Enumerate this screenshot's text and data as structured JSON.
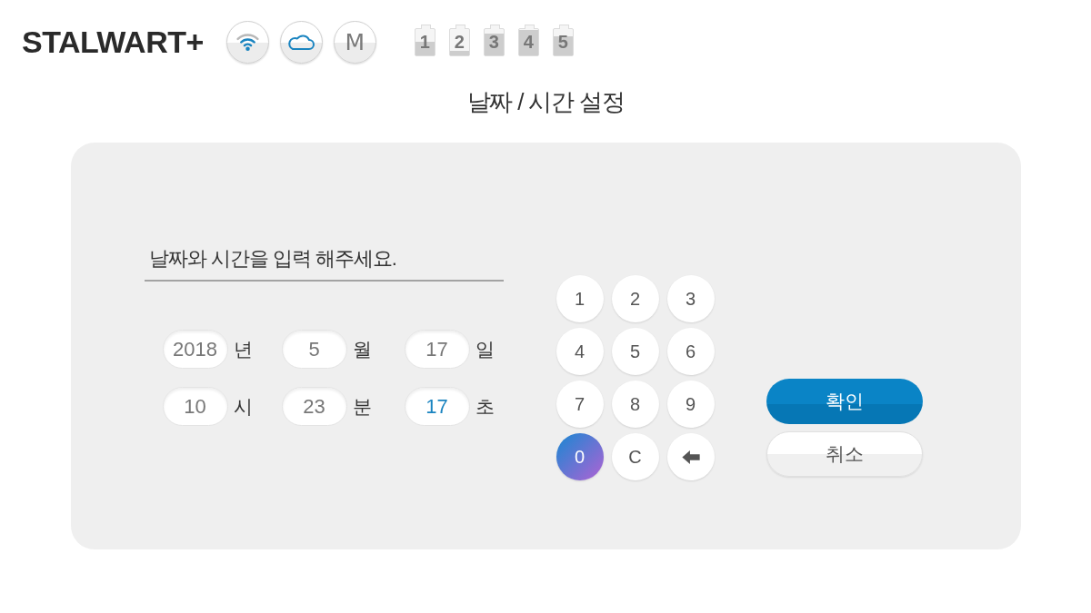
{
  "header": {
    "logo": "STALWART+",
    "status_letter": "M",
    "batteries": [
      {
        "label": "1",
        "level": 0.5
      },
      {
        "label": "2",
        "level": 0.15
      },
      {
        "label": "3",
        "level": 0.8
      },
      {
        "label": "4",
        "level": 0.95
      },
      {
        "label": "5",
        "level": 0.7
      }
    ]
  },
  "title": "날짜 / 시간 설정",
  "dialog": {
    "instruction": "날짜와 시간을 입력 해주세요.",
    "fields": [
      {
        "value": "2018",
        "unit": "년",
        "selected": false
      },
      {
        "value": "5",
        "unit": "월",
        "selected": false
      },
      {
        "value": "17",
        "unit": "일",
        "selected": false
      },
      {
        "value": "10",
        "unit": "시",
        "selected": false
      },
      {
        "value": "23",
        "unit": "분",
        "selected": false
      },
      {
        "value": "17",
        "unit": "초",
        "selected": true
      }
    ],
    "keypad": [
      {
        "kind": "key",
        "label": "1",
        "selected": false
      },
      {
        "kind": "key",
        "label": "2",
        "selected": false
      },
      {
        "kind": "key",
        "label": "3",
        "selected": false
      },
      {
        "kind": "key",
        "label": "4",
        "selected": false
      },
      {
        "kind": "key",
        "label": "5",
        "selected": false
      },
      {
        "kind": "key",
        "label": "6",
        "selected": false
      },
      {
        "kind": "key",
        "label": "7",
        "selected": false
      },
      {
        "kind": "key",
        "label": "8",
        "selected": false
      },
      {
        "kind": "key",
        "label": "9",
        "selected": false
      },
      {
        "kind": "key",
        "label": "0",
        "selected": true
      },
      {
        "kind": "key",
        "label": "C",
        "selected": false
      },
      {
        "kind": "backspace",
        "selected": false
      }
    ],
    "buttons": [
      {
        "kind": "primary",
        "label": "확인"
      },
      {
        "kind": "secondary",
        "label": "취소"
      }
    ]
  }
}
